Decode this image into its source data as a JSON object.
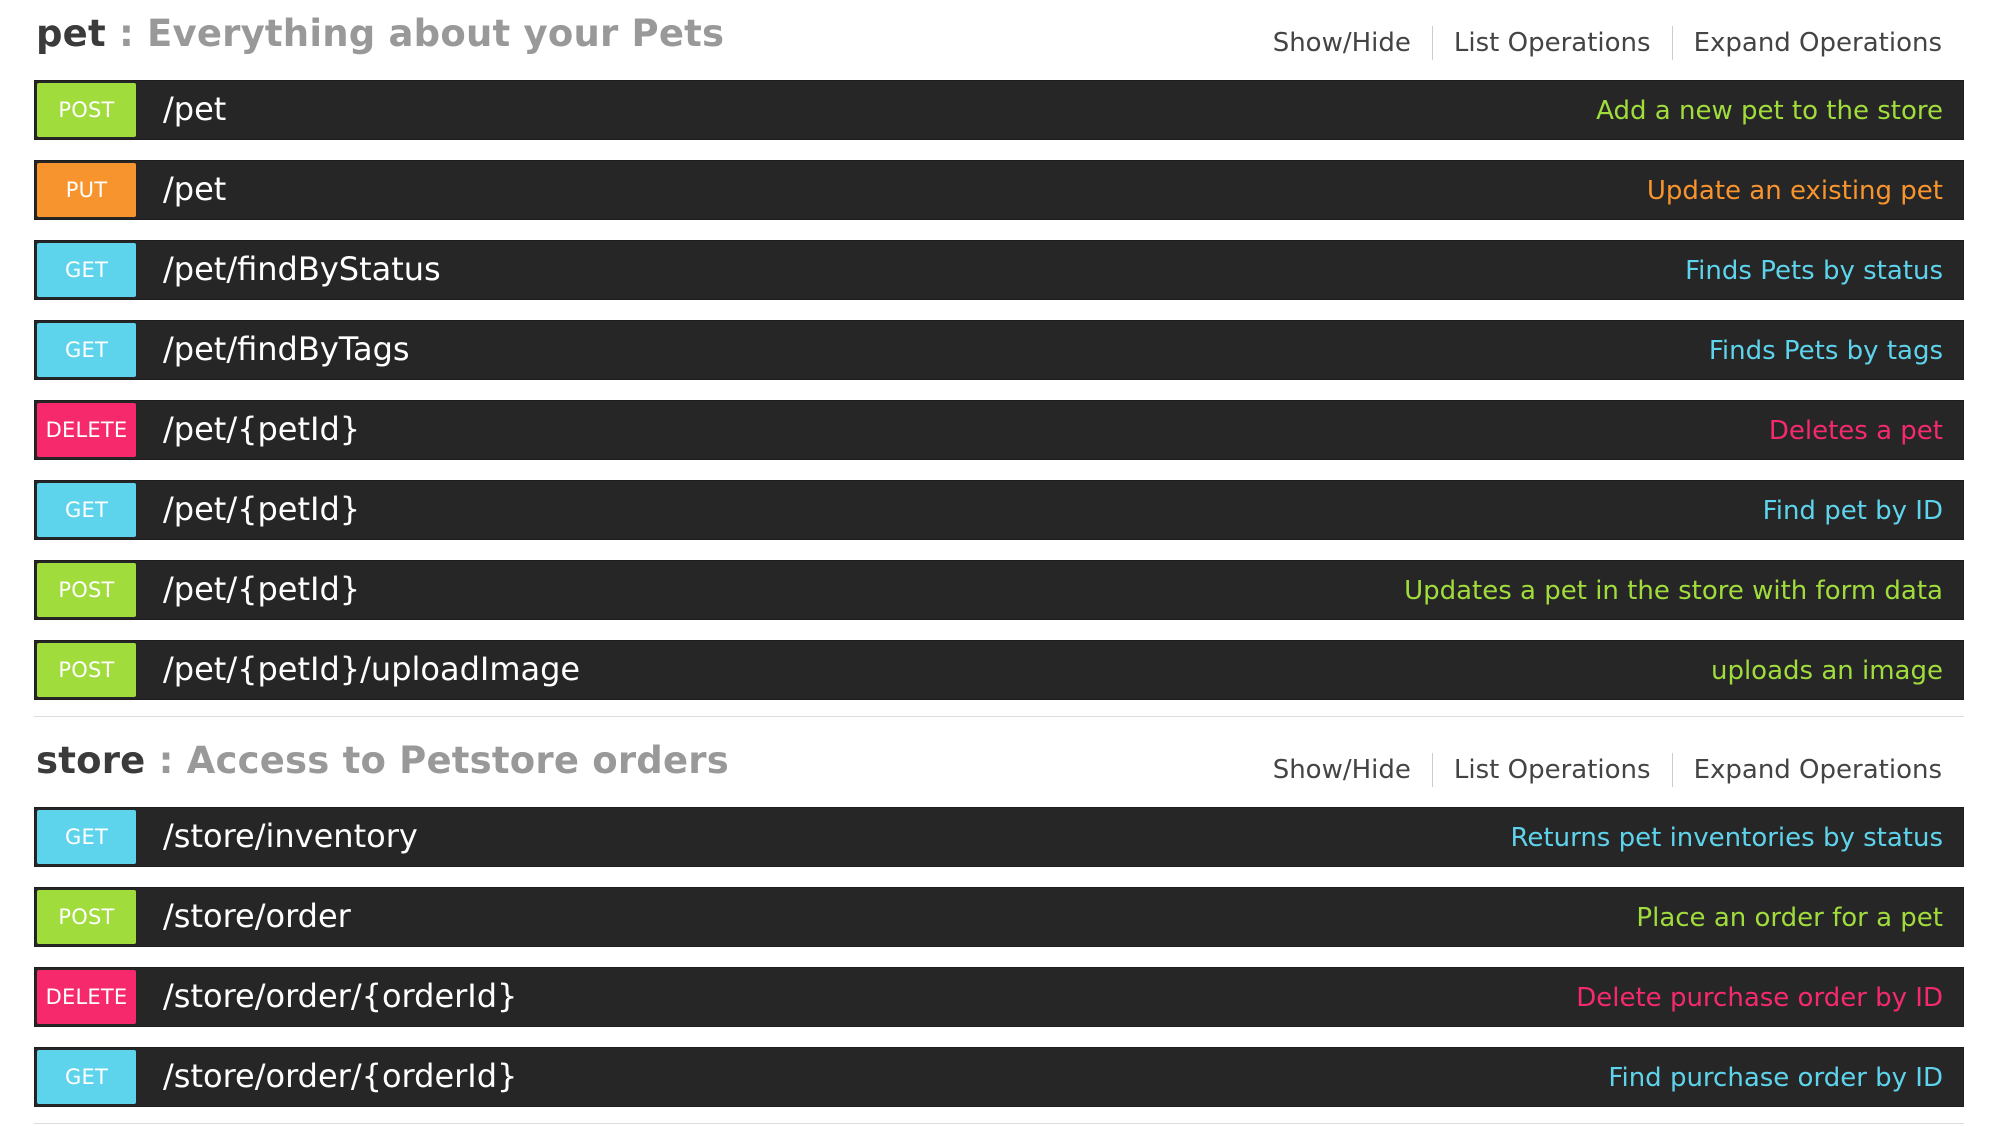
{
  "colors": {
    "POST": "#a0dc3c",
    "PUT": "#f7942e",
    "GET": "#5ed3ec",
    "DELETE": "#f5296c"
  },
  "sections": [
    {
      "name": "pet",
      "separator": " : ",
      "description": "Everything about your Pets",
      "ops": [
        "Show/Hide",
        "List Operations",
        "Expand Operations"
      ],
      "endpoints": [
        {
          "method": "POST",
          "path": "/pet",
          "summary": "Add a new pet to the store"
        },
        {
          "method": "PUT",
          "path": "/pet",
          "summary": "Update an existing pet"
        },
        {
          "method": "GET",
          "path": "/pet/findByStatus",
          "summary": "Finds Pets by status"
        },
        {
          "method": "GET",
          "path": "/pet/findByTags",
          "summary": "Finds Pets by tags"
        },
        {
          "method": "DELETE",
          "path": "/pet/{petId}",
          "summary": "Deletes a pet"
        },
        {
          "method": "GET",
          "path": "/pet/{petId}",
          "summary": "Find pet by ID"
        },
        {
          "method": "POST",
          "path": "/pet/{petId}",
          "summary": "Updates a pet in the store with form data"
        },
        {
          "method": "POST",
          "path": "/pet/{petId}/uploadImage",
          "summary": "uploads an image"
        }
      ]
    },
    {
      "name": "store",
      "separator": " : ",
      "description": "Access to Petstore orders",
      "ops": [
        "Show/Hide",
        "List Operations",
        "Expand Operations"
      ],
      "endpoints": [
        {
          "method": "GET",
          "path": "/store/inventory",
          "summary": "Returns pet inventories by status"
        },
        {
          "method": "POST",
          "path": "/store/order",
          "summary": "Place an order for a pet"
        },
        {
          "method": "DELETE",
          "path": "/store/order/{orderId}",
          "summary": "Delete purchase order by ID"
        },
        {
          "method": "GET",
          "path": "/store/order/{orderId}",
          "summary": "Find purchase order by ID"
        }
      ]
    }
  ]
}
